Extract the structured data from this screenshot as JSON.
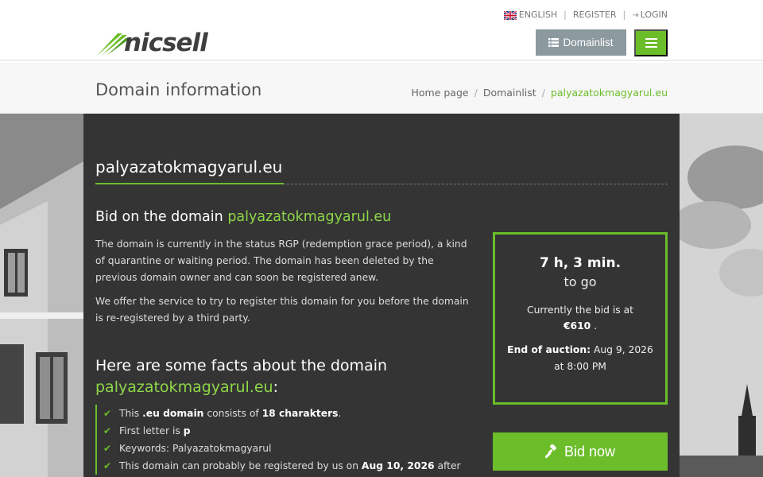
{
  "header": {
    "logo_text": "nicsell",
    "lang_label": "ENGLISH",
    "register_label": "REGISTER",
    "login_label": "LOGIN",
    "sep": "|",
    "domainlist_button": "Domainlist"
  },
  "titlebar": {
    "title": "Domain information",
    "breadcrumb": [
      "Home page",
      "Domainlist",
      "palyazatokmagyarul.eu"
    ],
    "bsep": "/"
  },
  "main": {
    "domain": "palyazatokmagyarul.eu",
    "bid_title_prefix": "Bid on the domain",
    "description_1": "The domain is currently in the status RGP (redemption grace period), a kind of quarantine or waiting period. The domain has been deleted by the previous domain owner and can soon be registered anew.",
    "description_2": "We offer the service to try to register this domain for you before the domain is re-registered by a third party.",
    "facts_title_prefix": "Here are some facts about the domain",
    "facts_title_suffix": ":",
    "facts": {
      "f1_a": "This",
      "f1_b": ".eu domain",
      "f1_c": "consists of",
      "f1_d": "18 charakters",
      "f1_e": ".",
      "f2_a": "First letter is",
      "f2_b": "p",
      "f3": "Keywords: Palyazatokmagyarul",
      "f4_a": "This domain can probably be registered by us on",
      "f4_b": "Aug 10, 2026",
      "f4_c": "after"
    }
  },
  "auction": {
    "countdown": "7 h, 3 min.",
    "to_go": "to go",
    "current_bid_label": "Currently the bid is at",
    "current_bid_value": "€610",
    "current_bid_end": ".",
    "end_label": "End of auction:",
    "end_value": "Aug 9, 2026 at 8:00 PM",
    "bid_button": "Bid now"
  },
  "colors": {
    "accent": "#6cbd2a",
    "panel": "#343434",
    "button_gray": "#8c999f"
  }
}
